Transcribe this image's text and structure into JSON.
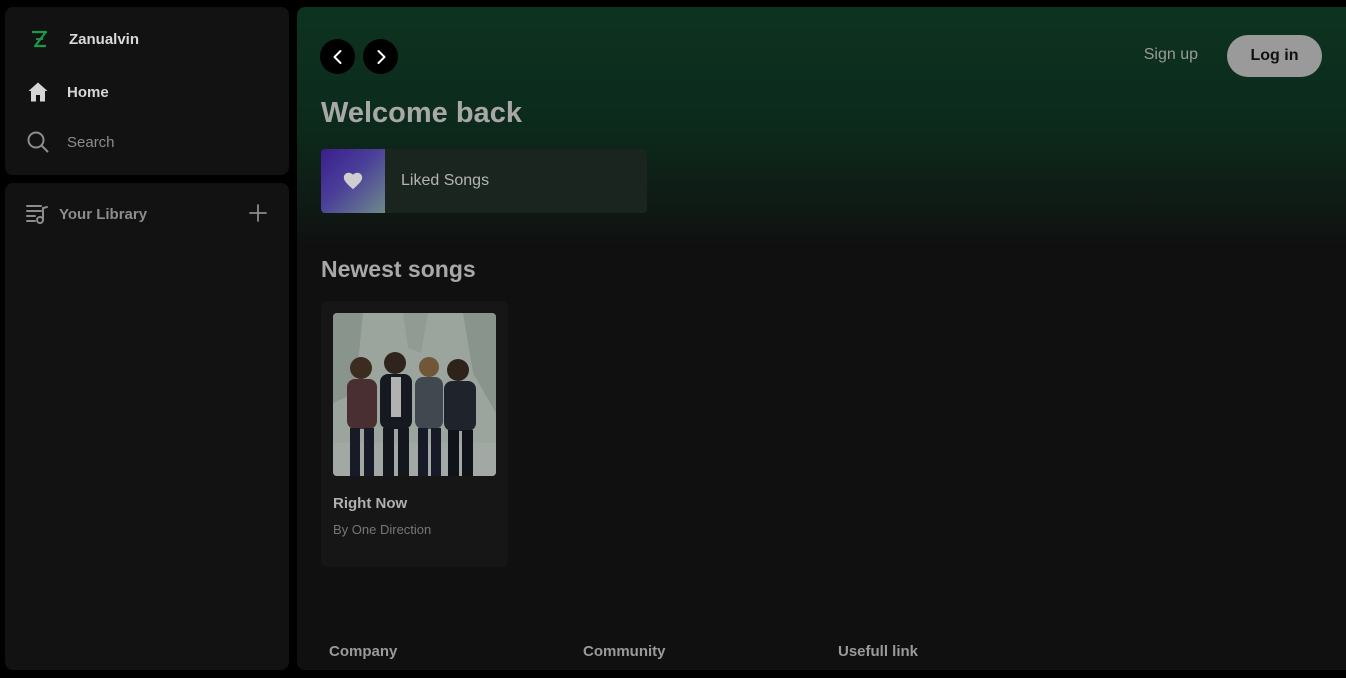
{
  "sidebar": {
    "brand": "Zanualvin",
    "home_label": "Home",
    "search_label": "Search",
    "library_label": "Your Library"
  },
  "header": {
    "signup_label": "Sign up",
    "login_label": "Log in"
  },
  "main": {
    "welcome": "Welcome back",
    "liked_label": "Liked Songs",
    "section_title": "Newest songs",
    "songs": [
      {
        "title": "Right Now",
        "artist": "By One Direction"
      }
    ]
  },
  "footer": {
    "columns": [
      "Company",
      "Community",
      "Usefull link"
    ]
  },
  "colors": {
    "accent_green": "#1db954",
    "header_gradient": "#0d3320",
    "panel": "#121212",
    "background": "#000000"
  },
  "icons": [
    "logo-icon",
    "home-icon",
    "search-icon",
    "library-icon",
    "plus-icon",
    "chevron-left-icon",
    "chevron-right-icon",
    "heart-icon"
  ]
}
